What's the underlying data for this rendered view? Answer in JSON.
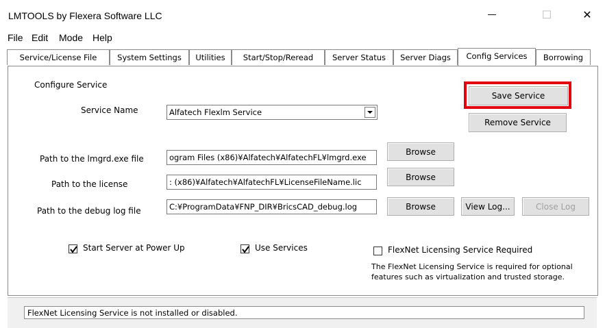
{
  "window": {
    "title": "LMTOOLS by Flexera Software LLC",
    "minimize_glyph": "—",
    "maximize_glyph": "☐",
    "close_glyph": "✕"
  },
  "menu": [
    "File",
    "Edit",
    "Mode",
    "Help"
  ],
  "tabs": [
    {
      "label": "Service/License File"
    },
    {
      "label": "System Settings"
    },
    {
      "label": "Utilities"
    },
    {
      "label": "Start/Stop/Reread"
    },
    {
      "label": "Server Status"
    },
    {
      "label": "Server Diags"
    },
    {
      "label": "Config Services",
      "active": true
    },
    {
      "label": "Borrowing"
    }
  ],
  "config": {
    "section_title": "Configure Service",
    "service_name_label": "Service Name",
    "service_name_value": "Alfatech Flexlm Service",
    "save_service": "Save Service",
    "remove_service": "Remove Service",
    "lmgrd_label": "Path to the lmgrd.exe file",
    "lmgrd_value": "ogram Files (x86)¥Alfatech¥AlfatechFL¥lmgrd.exe",
    "license_label": "Path to the license",
    "license_value": ": (x86)¥Alfatech¥AlfatechFL¥LicenseFileName.lic",
    "debug_label": "Path to the debug log file",
    "debug_value": "C:¥ProgramData¥FNP_DIR¥BricsCAD_debug.log",
    "browse": "Browse",
    "view_log": "View Log...",
    "close_log": "Close Log",
    "start_server_label": "Start Server at Power Up",
    "start_server_checked": true,
    "use_services_label": "Use Services",
    "use_services_checked": true,
    "flexnet_required_label": "FlexNet Licensing Service Required",
    "flexnet_required_checked": false,
    "flexnet_note_line1": "The FlexNet Licensing Service is required for optional",
    "flexnet_note_line2": "features such as virtualization and trusted storage."
  },
  "status_text": "FlexNet Licensing Service is not installed or disabled.",
  "colors": {
    "highlight": "#e3000f",
    "button_bg": "#e1e1e1"
  }
}
